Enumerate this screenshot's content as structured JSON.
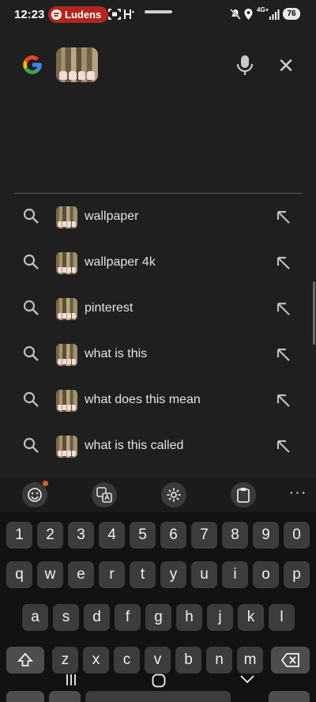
{
  "status_bar": {
    "time": "12:23",
    "media_app": "Ludens",
    "network_label": "4G+",
    "battery": "76",
    "icons": [
      "spotify-icon",
      "screenshot-icon",
      "hotspot-icon",
      "mute-icon",
      "location-icon",
      "network-icon",
      "signal-icon"
    ]
  },
  "search": {
    "logo": "G",
    "colors": {
      "blue": "#4285f4",
      "red": "#ea4335",
      "yellow": "#fbbc05",
      "green": "#34a853"
    },
    "close_label": "✕",
    "suggestions": [
      {
        "text": "wallpaper"
      },
      {
        "text": "wallpaper 4k"
      },
      {
        "text": "pinterest"
      },
      {
        "text": "what is this"
      },
      {
        "text": "what does this mean"
      },
      {
        "text": "what is this called"
      }
    ]
  },
  "keyboard": {
    "toolbar": [
      "emoji-icon",
      "translate-icon",
      "settings-icon",
      "clipboard-icon",
      "more-icon"
    ],
    "more_label": "···",
    "number_row": [
      "1",
      "2",
      "3",
      "4",
      "5",
      "6",
      "7",
      "8",
      "9",
      "0"
    ],
    "row1": [
      "q",
      "w",
      "e",
      "r",
      "t",
      "y",
      "u",
      "i",
      "o",
      "p"
    ],
    "row2": [
      "a",
      "s",
      "d",
      "f",
      "g",
      "h",
      "j",
      "k",
      "l"
    ],
    "row3": [
      "z",
      "x",
      "c",
      "v",
      "b",
      "n",
      "m"
    ]
  }
}
